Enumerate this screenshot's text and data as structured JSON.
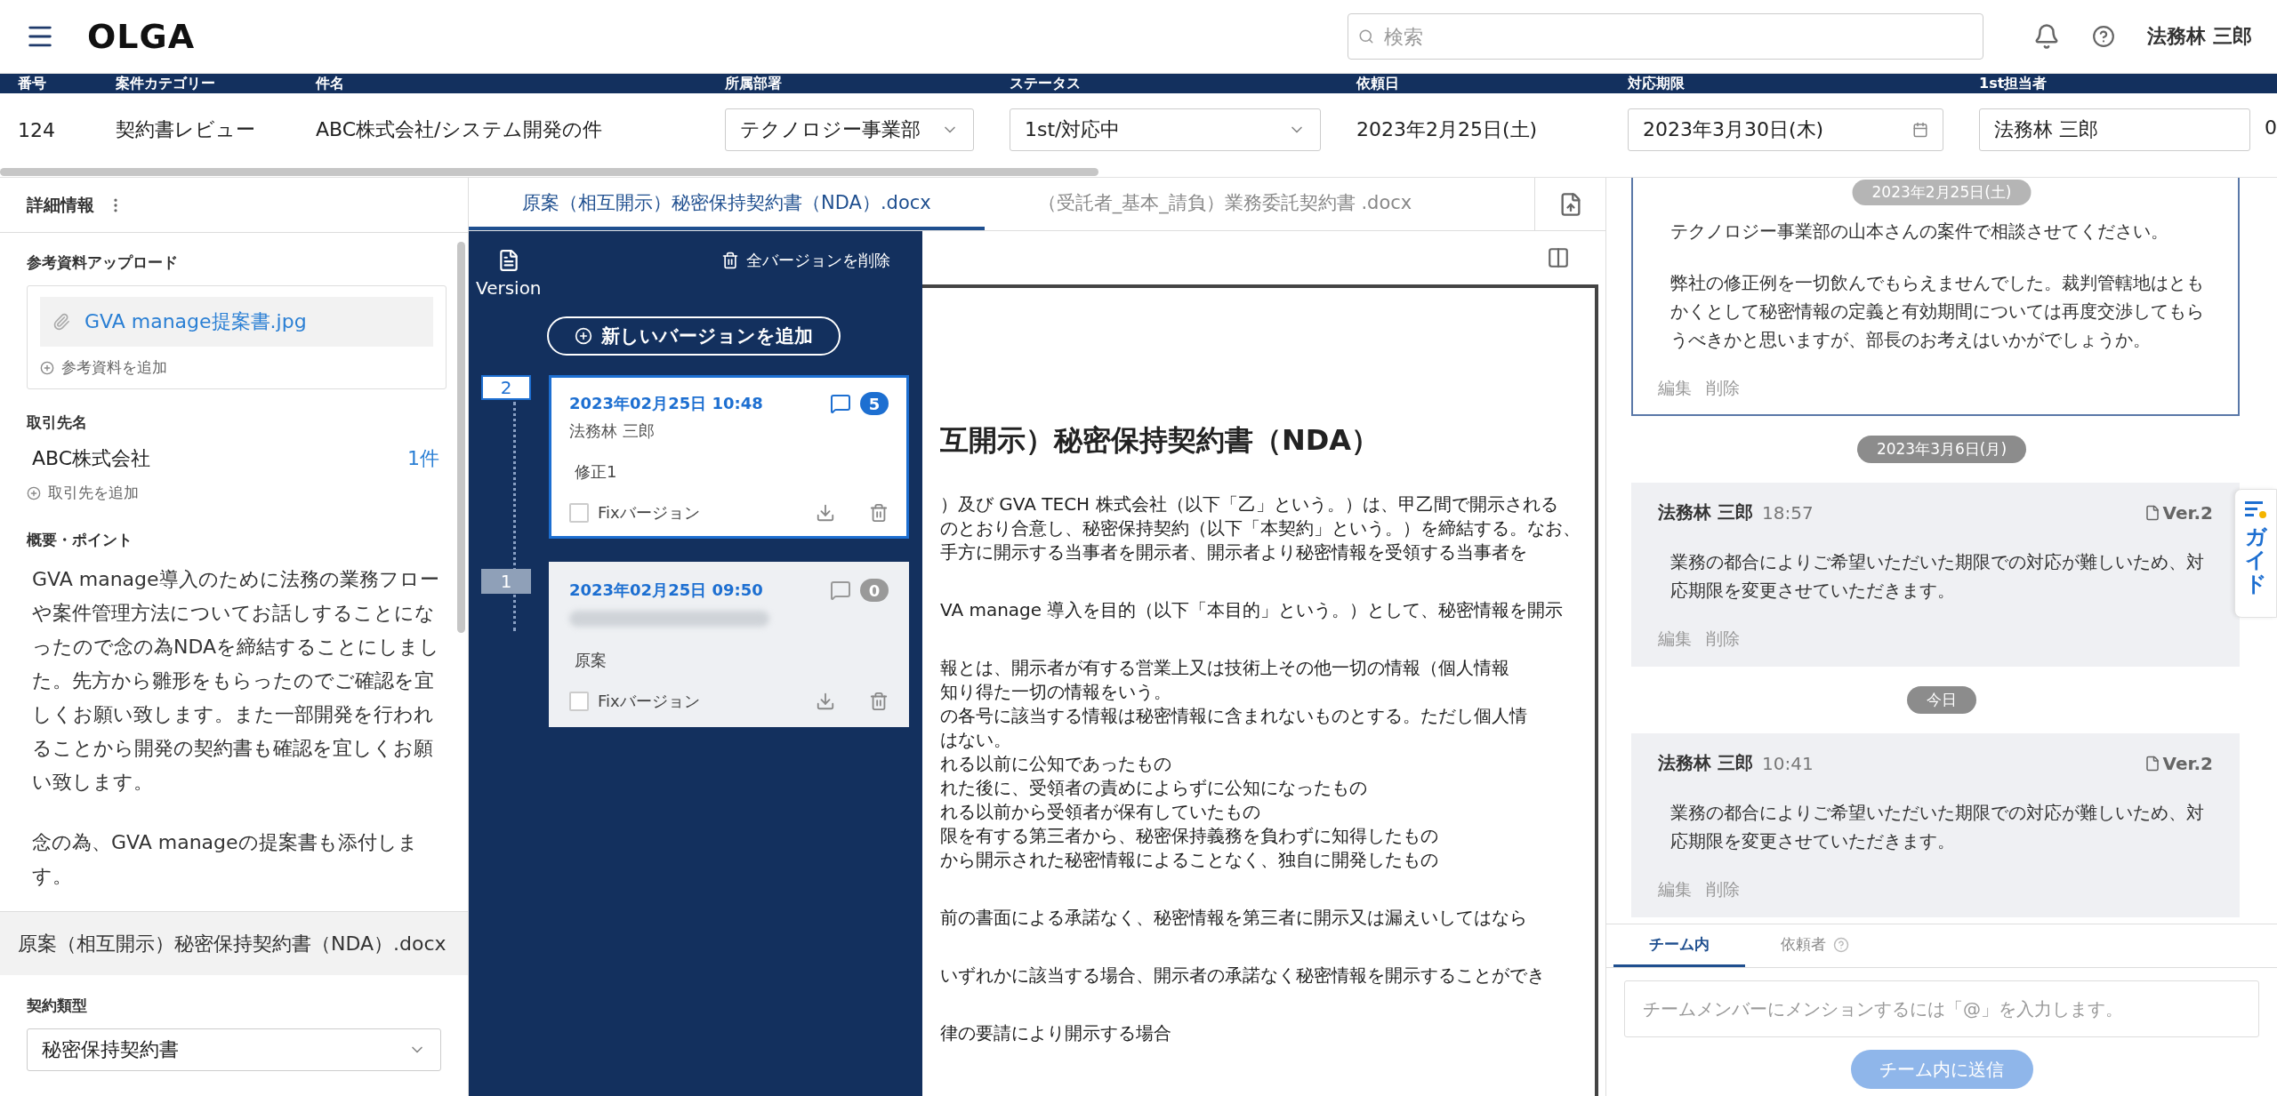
{
  "header": {
    "logo": "OLGA",
    "search": {
      "placeholder": "検索"
    },
    "user": "法務林 三郎"
  },
  "case_table": {
    "columns": [
      "番号",
      "案件カテゴリー",
      "件名",
      "所属部署",
      "ステータス",
      "依頼日",
      "対応期限",
      "1st担当者"
    ],
    "row": [
      {
        "kind": "text",
        "value": "124"
      },
      {
        "kind": "text",
        "value": "契約書レビュー"
      },
      {
        "kind": "text",
        "value": "ABC株式会社/システム開発の件"
      },
      {
        "kind": "select",
        "value": "テクノロジー事業部"
      },
      {
        "kind": "select",
        "value": "1st/対応中"
      },
      {
        "kind": "text",
        "value": "2023年2月25日(土)"
      },
      {
        "kind": "date",
        "value": "2023年3月30日(木)"
      },
      {
        "kind": "field",
        "value": "法務林 三郎"
      }
    ],
    "cut_value": "0"
  },
  "details": {
    "title": "詳細情報",
    "upload": {
      "label": "参考資料アップロード",
      "file": "GVA manage提案書.jpg",
      "add": "参考資料を追加"
    },
    "client": {
      "label": "取引先名",
      "name": "ABC株式会社",
      "count": "1件",
      "add": "取引先を追加"
    },
    "summary": {
      "label": "概要・ポイント",
      "paragraphs": [
        "GVA manage導入のために法務の業務フローや案件管理方法についてお話しすることになったので念の為NDAを締結することにしました。先方から雛形をもらったのでご確認を宜しくお願い致します。また一部開発を行われることから開発の契約書も確認を宜しくお願い致します。",
        "念の為、GVA manageの提案書も添付します。"
      ]
    },
    "document": "原案（相互開示）秘密保持契約書（NDA）.docx",
    "contract_type": {
      "label": "契約類型",
      "value": "秘密保持契約書"
    }
  },
  "doc_tabs": [
    {
      "label": "原案（相互開示）秘密保持契約書（NDA）.docx",
      "selected": true
    },
    {
      "label": "（受託者_基本_請負）業務委託契約書 .docx",
      "selected": false
    }
  ],
  "versions": {
    "title": "Version",
    "delete_all": "全バージョンを削除",
    "add": "新しいバージョンを追加",
    "items": [
      {
        "number": "2",
        "date": "2023年02月25日 10:48",
        "author": "法務林 三郎",
        "note": "修正1",
        "comments": "5",
        "fix_label": "Fixバージョン",
        "fixed": false,
        "selected": true
      },
      {
        "number": "1",
        "date": "2023年02月25日 09:50",
        "author_blurred": true,
        "note": "原案",
        "comments": "0",
        "fix_label": "Fixバージョン",
        "fixed": false,
        "selected": false
      }
    ]
  },
  "document_view": {
    "title": "互開示）秘密保持契約書（NDA）",
    "paragraphs": [
      [
        "）及び GVA TECH 株式会社（以下「乙」という。）は、甲乙間で開示される",
        "のとおり合意し、秘密保持契約（以下「本契約」という。）を締結する。なお、",
        "手方に開示する当事者を開示者、開示者より秘密情報を受領する当事者を"
      ],
      [
        "VA manage 導入を目的（以下「本目的」という。）として、秘密情報を開示"
      ],
      [
        "報とは、開示者が有する営業上又は技術上その他一切の情報（個人情報",
        "知り得た一切の情報をいう。",
        "の各号に該当する情報は秘密情報に含まれないものとする。ただし個人情",
        "はない。",
        "れる以前に公知であったもの",
        "れた後に、受領者の責めによらずに公知になったもの",
        "れる以前から受領者が保有していたもの",
        "限を有する第三者から、秘密保持義務を負わずに知得したもの",
        "から開示された秘密情報によることなく、独自に開発したもの"
      ],
      [
        "前の書面による承諾なく、秘密情報を第三者に開示又は漏えいしてはなら"
      ],
      [
        "いずれかに該当する場合、開示者の承諾なく秘密情報を開示することができ"
      ],
      [
        "律の要請により開示する場合"
      ]
    ]
  },
  "chat": {
    "sticky_date": "2023年2月25日(土)",
    "items": [
      {
        "kind": "comment",
        "selected": true,
        "body": [
          "テクノロジー事業部の山本さんの案件で相談させてください。",
          "弊社の修正例を一切飲んでもらえませんでした。裁判管轄地はともかくとして秘密情報の定義と有効期間については再度交渉してもらうべきかと思いますが、部長のお考えはいかがでしょうか。"
        ],
        "actions": [
          "編集",
          "削除"
        ]
      },
      {
        "kind": "date",
        "label": "2023年3月6日(月)"
      },
      {
        "kind": "comment",
        "selected": false,
        "author": "法務林 三郎",
        "time": "18:57",
        "version": "Ver.2",
        "body": [
          "業務の都合によりご希望いただいた期限での対応が難しいため、対応期限を変更させていただきます。"
        ],
        "actions": [
          "編集",
          "削除"
        ]
      },
      {
        "kind": "date",
        "label": "今日"
      },
      {
        "kind": "comment",
        "selected": false,
        "author": "法務林 三郎",
        "time": "10:41",
        "version": "Ver.2",
        "body": [
          "業務の都合によりご希望いただいた期限での対応が難しいため、対応期限を変更させていただきます。"
        ],
        "actions": [
          "編集",
          "削除"
        ]
      }
    ],
    "tabs": [
      {
        "label": "チーム内",
        "selected": true,
        "help": false
      },
      {
        "label": "依頼者",
        "selected": false,
        "help": true
      }
    ],
    "input": {
      "placeholder": "チームメンバーにメンションするには「@」を入力します。"
    },
    "send": {
      "label": "チーム内に送信",
      "disabled": true
    }
  },
  "guide": {
    "label": "ガイド"
  }
}
